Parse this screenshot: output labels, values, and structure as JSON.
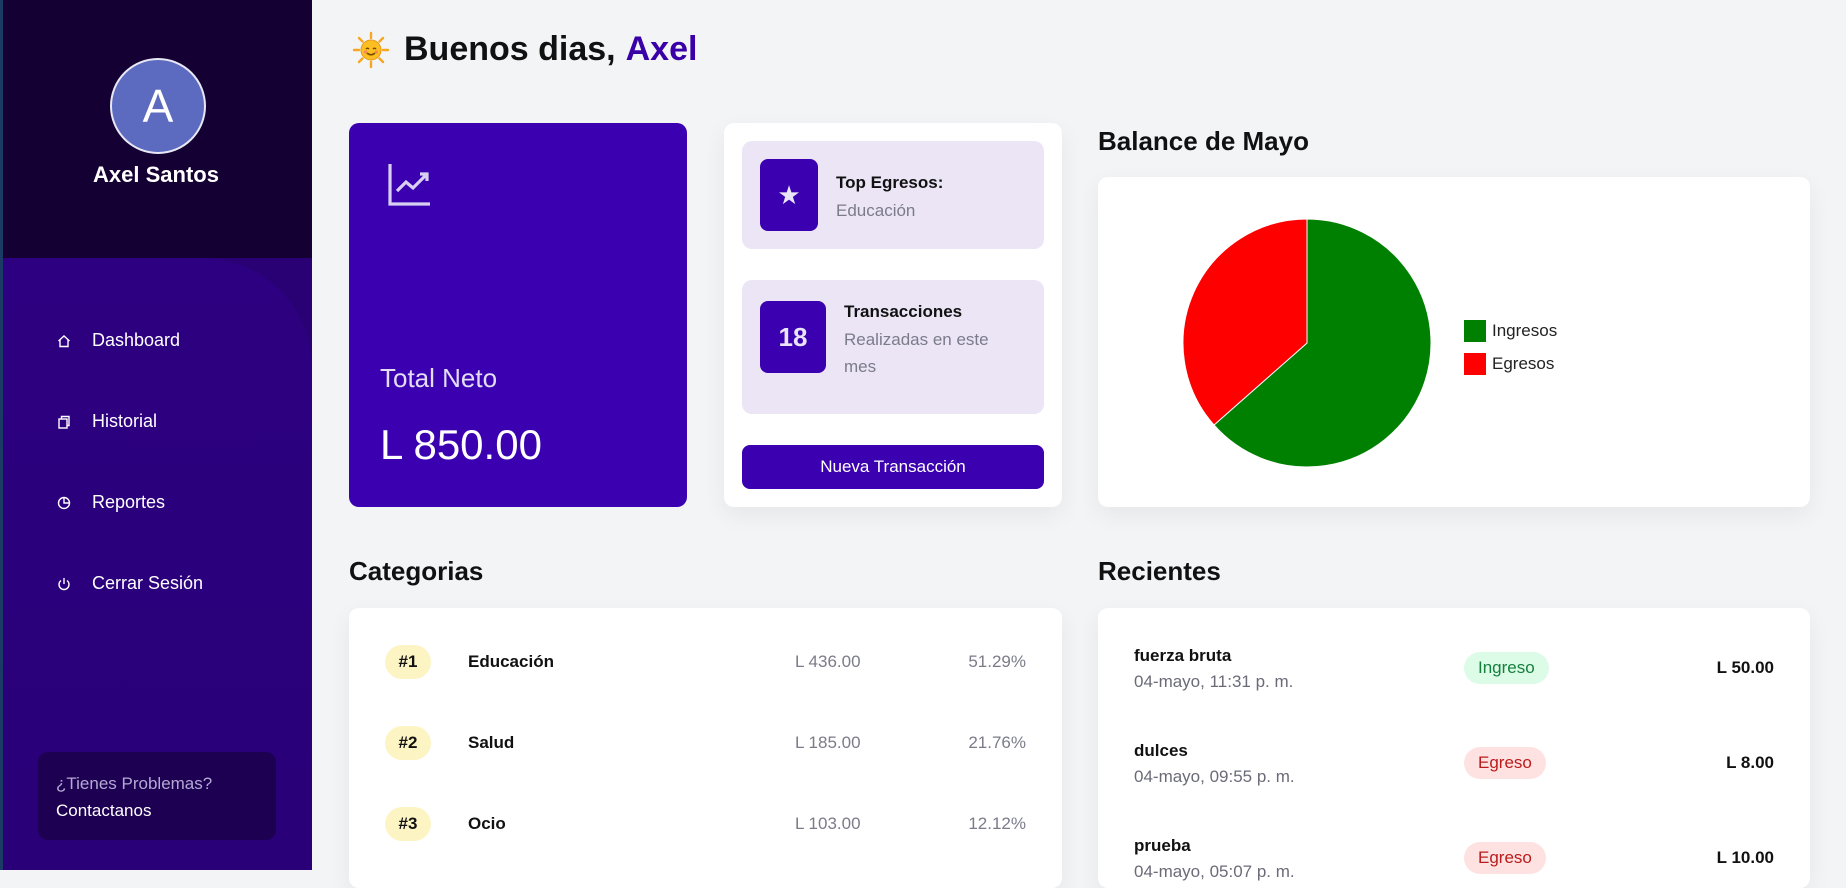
{
  "user": {
    "initial": "A",
    "name": "Axel Santos"
  },
  "nav": [
    {
      "label": "Dashboard",
      "icon": "home-icon"
    },
    {
      "label": "Historial",
      "icon": "copy-icon"
    },
    {
      "label": "Reportes",
      "icon": "pie-chart-icon"
    },
    {
      "label": "Cerrar Sesión",
      "icon": "power-icon"
    }
  ],
  "help": {
    "question": "¿Tienes Problemas?",
    "contact": "Contactanos"
  },
  "greeting": {
    "text": "Buenos dias,",
    "name": "Axel"
  },
  "total": {
    "label": "Total Neto",
    "value": "L 850.00"
  },
  "top_expenses": {
    "title": "Top Egresos:",
    "value": "Educación"
  },
  "transactions": {
    "count": "18",
    "title": "Transacciones",
    "subtitle": "Realizadas en este mes"
  },
  "new_transaction_label": "Nueva Transacción",
  "balance": {
    "title": "Balance de Mayo"
  },
  "chart_data": {
    "type": "pie",
    "labels": [
      "Ingresos",
      "Egresos"
    ],
    "values": [
      63.5,
      36.5
    ],
    "colors": [
      "#008000",
      "#ff0000"
    ],
    "legend": "right"
  },
  "categories_title": "Categorias",
  "categories": [
    {
      "rank": "#1",
      "name": "Educación",
      "amount": "L 436.00",
      "percent": "51.29%"
    },
    {
      "rank": "#2",
      "name": "Salud",
      "amount": "L 185.00",
      "percent": "21.76%"
    },
    {
      "rank": "#3",
      "name": "Ocio",
      "amount": "L 103.00",
      "percent": "12.12%"
    }
  ],
  "recent_title": "Recientes",
  "recent": [
    {
      "name": "fuerza bruta",
      "date": "04-mayo, 11:31 p. m.",
      "type": "Ingreso",
      "amount": "L 50.00"
    },
    {
      "name": "dulces",
      "date": "04-mayo, 09:55 p. m.",
      "type": "Egreso",
      "amount": "L 8.00"
    },
    {
      "name": "prueba",
      "date": "04-mayo, 05:07 p. m.",
      "type": "Egreso",
      "amount": "L 10.00"
    }
  ]
}
